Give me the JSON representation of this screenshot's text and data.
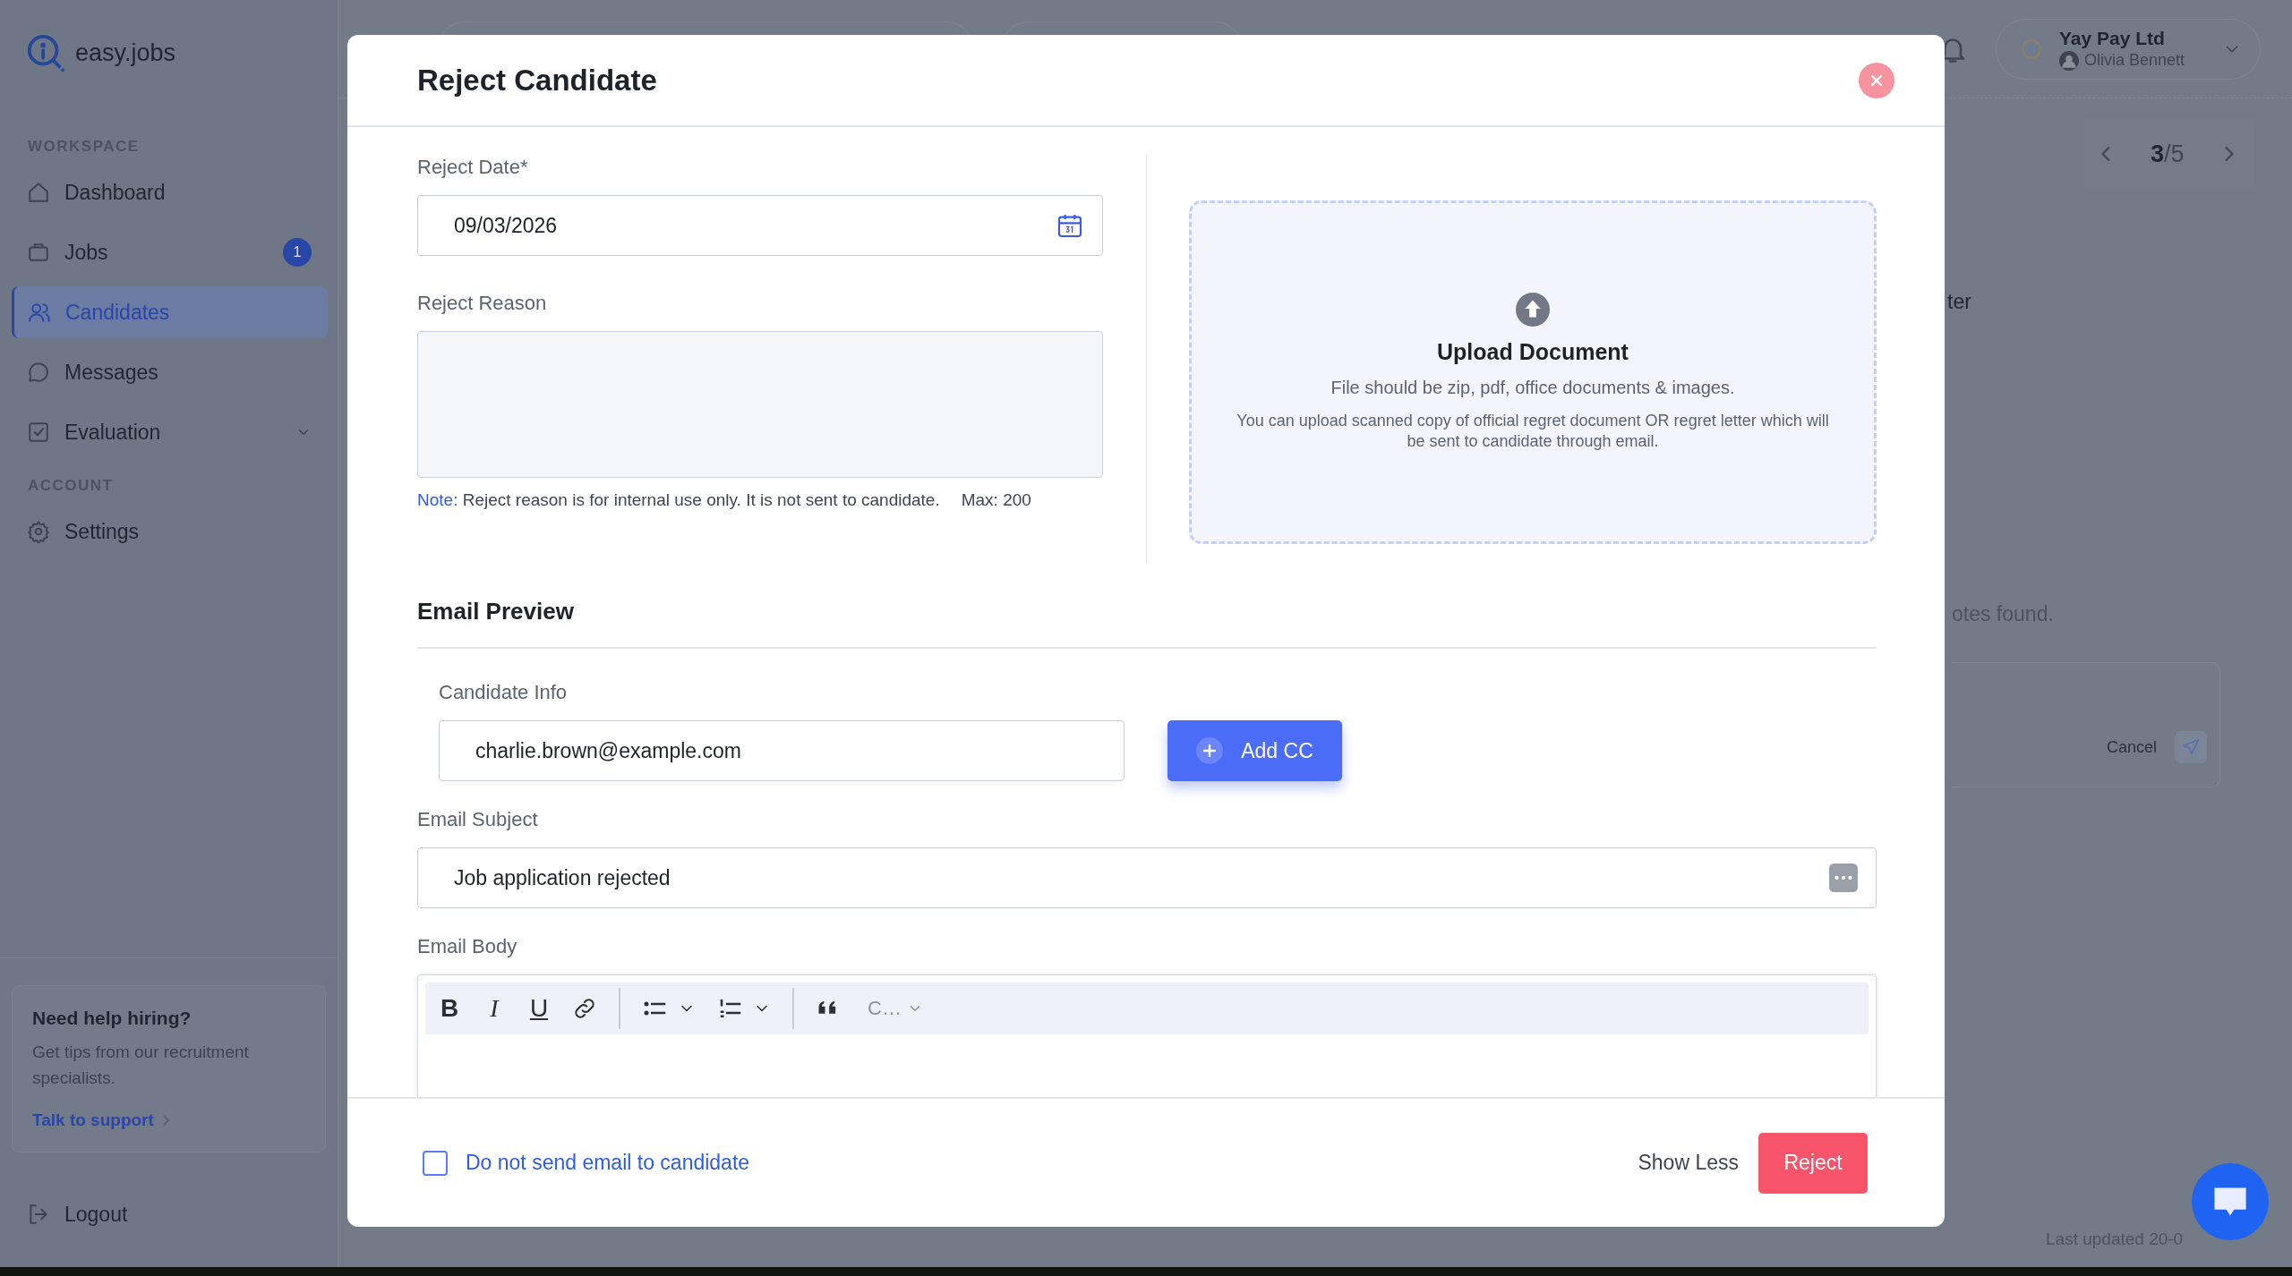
{
  "sidebar": {
    "logo": "easy.jobs",
    "sections": [
      {
        "heading": "WORKSPACE",
        "items": [
          {
            "kind": "home",
            "label": "Dashboard",
            "selected": false
          },
          {
            "kind": "jobs",
            "label": "Jobs",
            "selected": false,
            "badge": "1"
          },
          {
            "kind": "users",
            "label": "Candidates",
            "selected": true
          },
          {
            "kind": "chat",
            "label": "Messages",
            "selected": false
          },
          {
            "kind": "check",
            "label": "Evaluation",
            "selected": false,
            "expandable": true
          }
        ]
      },
      {
        "heading": "ACCOUNT",
        "items": [
          {
            "kind": "gear",
            "label": "Settings",
            "selected": false
          }
        ]
      }
    ],
    "help_card": {
      "title": "Need help hiring?",
      "text": "Get tips from our recruitment specialists.",
      "link": "Talk to support"
    },
    "logout": "Logout"
  },
  "header": {
    "company": "Yay Pay Ltd",
    "user": "Olivia Bennett"
  },
  "background": {
    "pager": "**3**/5",
    "fragment_1": "ter",
    "fragment_2": "otes found.",
    "cancel": "Cancel",
    "last_updated": "Last updated 20-0"
  },
  "modal": {
    "title": "Reject Candidate",
    "reject_date": {
      "label": "Reject Date*",
      "value": "09/03/2026"
    },
    "reject_reason": {
      "label": "Reject Reason",
      "note_label": "Note:",
      "note": "Reject reason is for internal use only. It is not sent to candidate.",
      "max": "Max: 200"
    },
    "upload": {
      "title": "Upload Document",
      "hint": "File should be zip, pdf, office documents & images.",
      "description": "You can upload scanned copy of official regret document OR regret letter which will be sent to candidate through email."
    },
    "email_preview": {
      "title": "Email Preview",
      "candidate_label": "Candidate Info",
      "candidate_email": "charlie.brown@example.com",
      "add_cc": "Add CC",
      "subject_label": "Email Subject",
      "subject_value": "Job application rejected",
      "body_label": "Email Body",
      "toolbar": [
        {
          "kind": "bold",
          "glyph": "B"
        },
        {
          "kind": "italic",
          "glyph": "I"
        },
        {
          "kind": "underline",
          "glyph": "U"
        },
        {
          "kind": "link"
        },
        {
          "kind": "separator"
        },
        {
          "kind": "bullet-list"
        },
        {
          "kind": "dropdown"
        },
        {
          "kind": "numbered-list"
        },
        {
          "kind": "dropdown"
        },
        {
          "kind": "separator"
        },
        {
          "kind": "quote"
        },
        {
          "kind": "style-select",
          "label": "C…"
        }
      ]
    },
    "footer": {
      "checkbox": {
        "label": "Do not send email to candidate",
        "checked": false
      },
      "show_less": "Show Less",
      "reject": "Reject"
    }
  }
}
